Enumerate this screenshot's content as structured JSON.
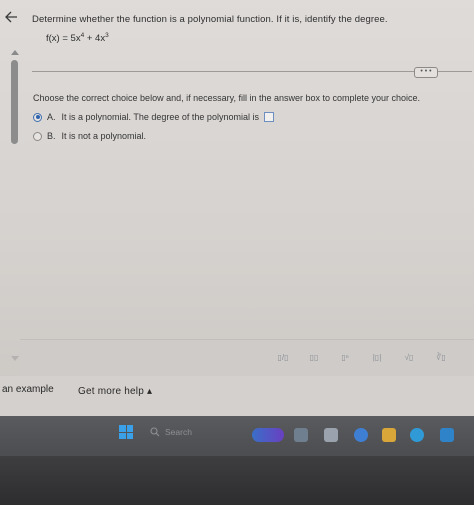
{
  "question": {
    "prompt": "Determine whether the function is a polynomial function. If it is, identify the degree.",
    "function_lhs": "f(x) = 5x",
    "exp1": "4",
    "function_mid": " + 4x",
    "exp2": "3"
  },
  "instructions": "Choose the correct choice below and, if necessary, fill in the answer box to complete your choice.",
  "choices": [
    {
      "letter": "A.",
      "text": "It is a polynomial. The degree of the polynomial is",
      "selected": true
    },
    {
      "letter": "B.",
      "text": "It is not a polynomial.",
      "selected": false
    }
  ],
  "dots_label": "• • •",
  "toolbar": {
    "tools": [
      "▯/▯",
      "▯▯",
      "▯ⁿ",
      "|▯|",
      "√▯",
      "∛▯"
    ]
  },
  "footer": {
    "example_label": "an example",
    "help_label": "Get more help ▴"
  },
  "taskbar": {
    "search_placeholder": "Search"
  }
}
